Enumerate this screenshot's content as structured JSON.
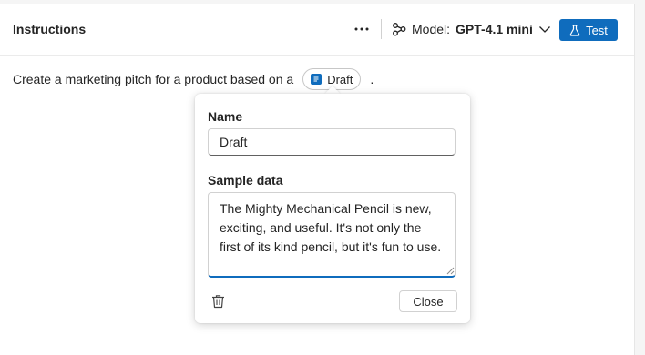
{
  "header": {
    "title": "Instructions",
    "more_icon": "more-horizontal-icon",
    "model_icon": "model-nodes-icon",
    "model_label": "Model:",
    "model_value": "GPT-4.1 mini",
    "test_label": "Test",
    "test_icon": "flask-icon"
  },
  "instruction": {
    "text": "Create a marketing pitch for a product based on a",
    "chip_label": "Draft",
    "chip_icon": "variable-icon",
    "trailing": "."
  },
  "popover": {
    "name_label": "Name",
    "name_value": "Draft",
    "sample_label": "Sample data",
    "sample_value": "The Mighty Mechanical Pencil is new, exciting, and useful. It's not only the first of its kind pencil, but it's fun to use.",
    "delete_icon": "trash-icon",
    "close_label": "Close"
  },
  "colors": {
    "accent": "#0f6cbd",
    "text": "#242424",
    "border": "#d1d1d1"
  }
}
